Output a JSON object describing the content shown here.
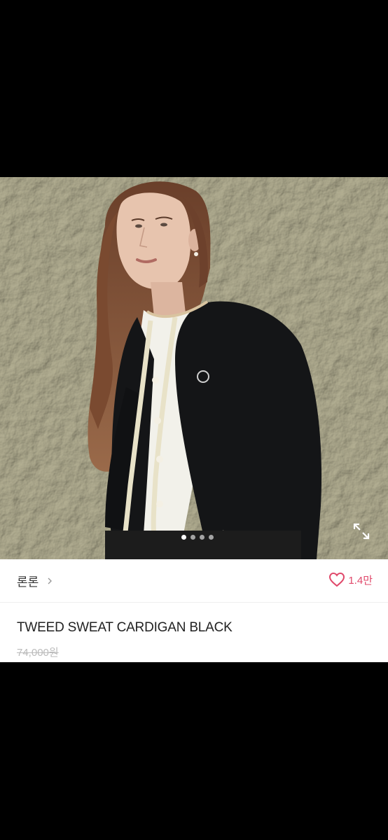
{
  "product": {
    "brand": "론론",
    "likes": "1.4만",
    "title": "TWEED SWEAT CARDIGAN BLACK",
    "price": "74,000원"
  },
  "gallery": {
    "image_alt": "model wearing black tweed cardigan",
    "slide_count": 4,
    "active_slide": 1
  },
  "colors": {
    "like_accent": "#e0486a",
    "price_muted": "#bbbbbb"
  },
  "icons": {
    "expand": "expand-arrows-icon",
    "heart": "heart-outline-icon",
    "chevron": "chevron-right-icon"
  }
}
